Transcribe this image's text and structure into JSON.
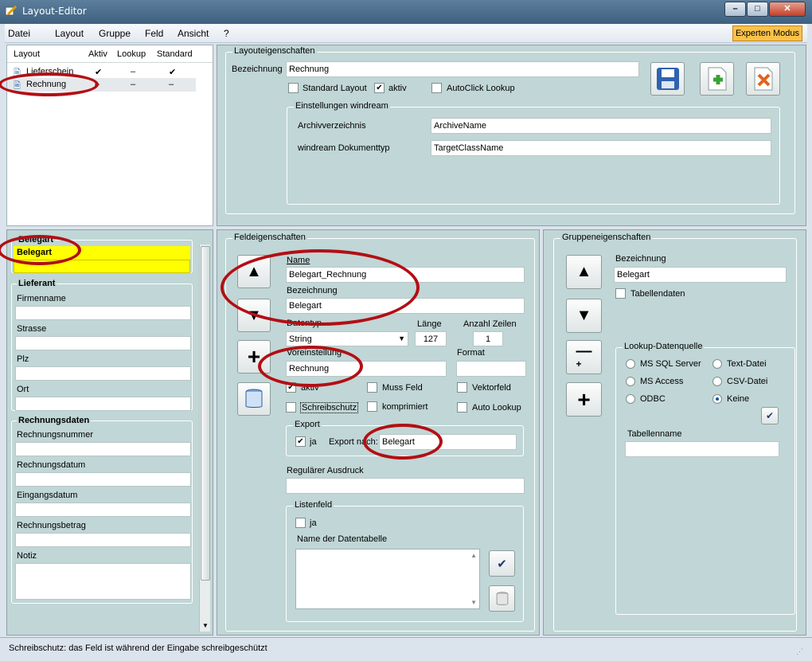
{
  "window": {
    "title": "Layout-Editor"
  },
  "menu": [
    "Datei",
    "Layout",
    "Gruppe",
    "Feld",
    "Ansicht",
    "?"
  ],
  "expert_button": "Experten Modus",
  "layout_list": {
    "headers": [
      "Layout",
      "Aktiv",
      "Lookup",
      "Standard"
    ],
    "rows": [
      {
        "name": "Lieferschein",
        "aktiv": "✔",
        "lookup": "–",
        "standard": "✔"
      },
      {
        "name": "Rechnung",
        "aktiv": "–",
        "lookup": "–",
        "standard": "–"
      }
    ]
  },
  "layout_props": {
    "title": "Layouteigenschaften",
    "bezeichnung_label": "Bezeichnung",
    "bezeichnung_value": "Rechnung",
    "standard_layout": "Standard Layout",
    "aktiv": "aktiv",
    "autoclick": "AutoClick Lookup",
    "windream_title": "Einstellungen windream",
    "archiv_label": "Archivverzeichnis",
    "archiv_value": "ArchiveName",
    "doctype_label": "windream Dokumenttyp",
    "doctype_value": "TargetClassName"
  },
  "form_preview": {
    "belegart_group": "Belegart",
    "belegart_field": "Belegart",
    "lieferant": {
      "title": "Lieferant",
      "fields": [
        "Firmenname",
        "Strasse",
        "Plz",
        "Ort"
      ]
    },
    "rechnung": {
      "title": "Rechnungsdaten",
      "fields": [
        "Rechnungsnummer",
        "Rechnungsdatum",
        "Eingangsdatum",
        "Rechnungsbetrag",
        "Notiz"
      ]
    }
  },
  "field_props": {
    "title": "Feldeigenschaften",
    "name_label": "Name",
    "name_value": "Belegart_Rechnung",
    "bez_label": "Bezeichnung",
    "bez_value": "Belegart",
    "datentyp_label": "Datentyp",
    "datentyp_value": "String",
    "laenge_label": "Länge",
    "laenge_value": "127",
    "zeilen_label": "Anzahl Zeilen",
    "zeilen_value": "1",
    "voreinstellung_label": "Voreinstellung",
    "voreinstellung_value": "Rechnung",
    "format_label": "Format",
    "aktiv": "aktiv",
    "muss": "Muss Feld",
    "vektor": "Vektorfeld",
    "schreibschutz": "Schreibschutz",
    "komprimiert": "komprimiert",
    "autolookup": "Auto Lookup",
    "export_title": "Export",
    "export_ja": "ja",
    "export_nach_label": "Export nach:",
    "export_nach_value": "Belegart",
    "regex_label": "Regulärer Ausdruck",
    "listenfeld_title": "Listenfeld",
    "listen_ja": "ja",
    "datentabelle_label": "Name der Datentabelle"
  },
  "group_props": {
    "title": "Gruppeneigenschaften",
    "bez_label": "Bezeichnung",
    "bez_value": "Belegart",
    "tabellendaten": "Tabellendaten",
    "lookup_title": "Lookup-Datenquelle",
    "sources": [
      "MS SQL Server",
      "Text-Datei",
      "MS Access",
      "CSV-Datei",
      "ODBC",
      "Keine"
    ],
    "selected_source": "Keine",
    "tabellenname_label": "Tabellenname"
  },
  "status": "Schreibschutz: das Feld ist während der Eingabe schreibgeschützt",
  "colors": {
    "highlight": "#ffff00",
    "annotation": "#b20f14",
    "panel": "#c1d6d6"
  }
}
